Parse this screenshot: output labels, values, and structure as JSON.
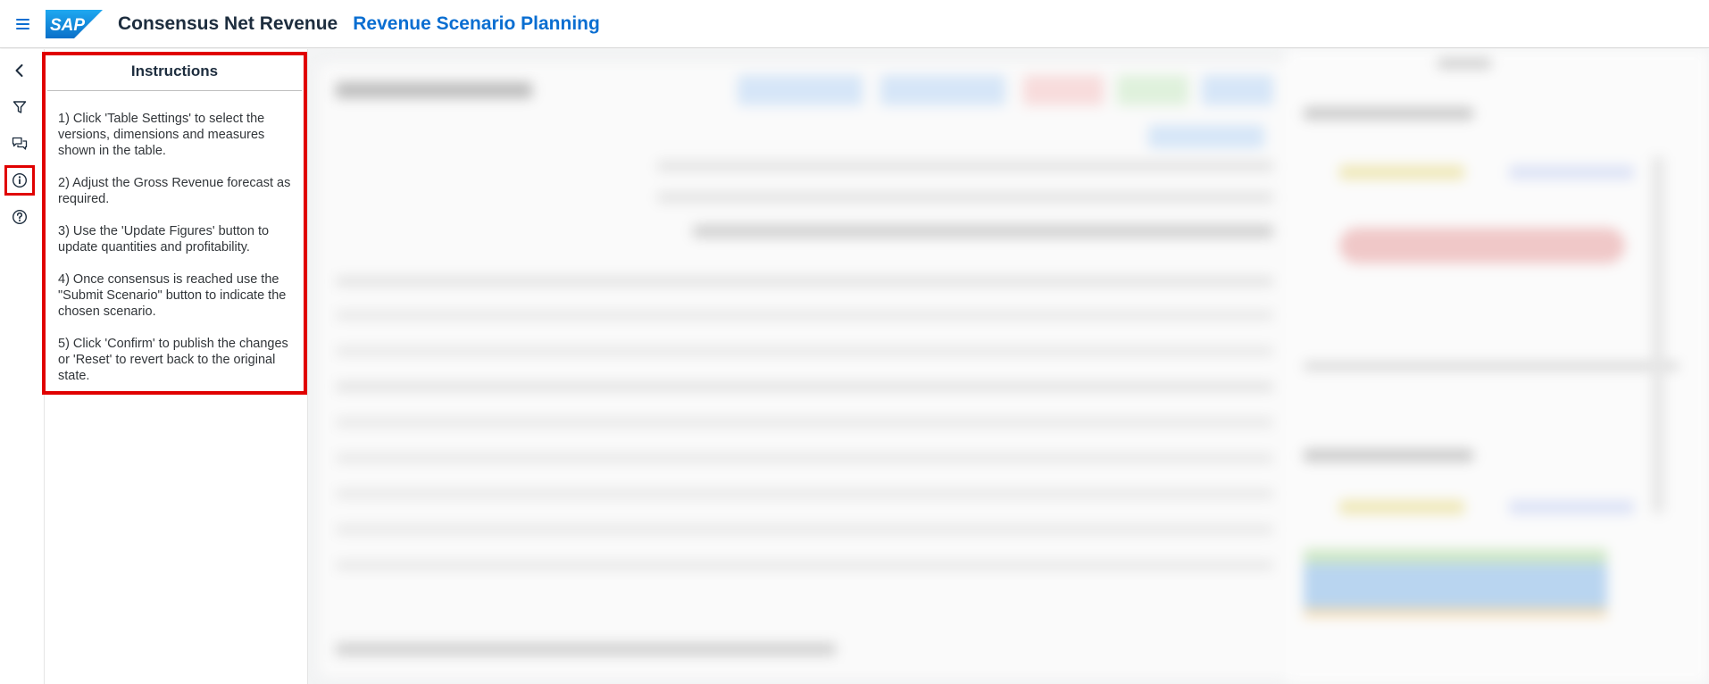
{
  "shell": {
    "app_title": "Consensus Net Revenue",
    "story_title": "Revenue Scenario Planning",
    "logo_text": "SAP"
  },
  "rail": {
    "icons": [
      "chevron-left-icon",
      "filter-icon",
      "comments-icon",
      "info-icon",
      "help-icon"
    ]
  },
  "instructions": {
    "title": "Instructions",
    "steps": [
      "1) Click 'Table Settings' to select the versions, dimensions and measures shown in the table.",
      "2) Adjust the Gross Revenue forecast as required.",
      "3) Use the 'Update Figures' button to update quantities and profitability.",
      "4) Once consensus is reached use the \"Submit Scenario\" button to indicate the chosen scenario.",
      "5) Click 'Confirm' to publish the changes or 'Reset' to revert back to the original state."
    ]
  },
  "colors": {
    "brand_blue": "#0a6ed1",
    "highlight_red": "#e00000"
  }
}
